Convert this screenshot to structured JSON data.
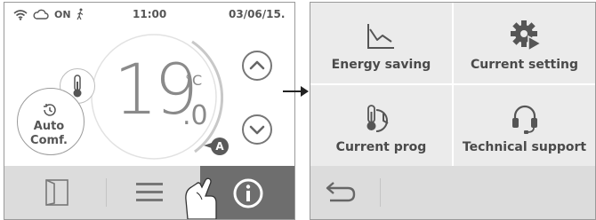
{
  "status": {
    "on_label": "ON",
    "time": "11:00",
    "date": "03/06/15."
  },
  "thermostat": {
    "temperature_int": "19",
    "temperature_dec": ".0",
    "unit": "°C",
    "mode_line1": "Auto",
    "mode_line2": "Comf.",
    "badge": "A"
  },
  "menu": {
    "items": [
      {
        "label": "Energy saving",
        "icon": "chart-icon"
      },
      {
        "label": "Current setting",
        "icon": "gear-play-icon"
      },
      {
        "label": "Current prog",
        "icon": "thermometer-clock-icon"
      },
      {
        "label": "Technical support",
        "icon": "headset-icon"
      }
    ]
  },
  "colors": {
    "panel_bg": "#ffffff",
    "bar_bg": "#dcdcdc",
    "active_tab": "#6e6e6e",
    "menu_cell": "#ebebeb",
    "icon_color": "#555555"
  }
}
